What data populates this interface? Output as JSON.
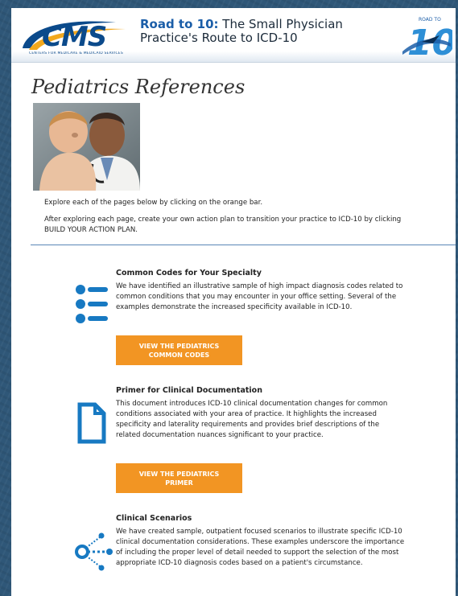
{
  "header": {
    "logo_text": "CMS",
    "logo_subtitle": "CENTERS FOR MEDICARE & MEDICAID SERVICES",
    "title_bold": "Road to 10:",
    "title_rest": " The Small Physician Practice's Route to ICD-10",
    "badge_top": "ROAD TO",
    "badge_number": "10"
  },
  "page": {
    "title": "Pediatrics References",
    "intro_1": "Explore each of the pages below by clicking on the orange bar.",
    "intro_2": "After exploring each page, create your own action plan to transition your practice to ICD-10 by clicking BUILD YOUR ACTION PLAN."
  },
  "sections": [
    {
      "title": "Common Codes for Your Specialty",
      "body": "We have identified an illustrative sample of high impact diagnosis codes related to common conditions that you may encounter in your office setting. Several of the examples demonstrate the increased specificity available in ICD-10.",
      "button_line1": "VIEW THE PEDIATRICS",
      "button_line2": "COMMON CODES",
      "icon": "list-icon"
    },
    {
      "title": "Primer for Clinical Documentation",
      "body": "This document introduces ICD-10 clinical documentation changes for common conditions associated with your area of practice. It highlights the increased specificity and laterality requirements and provides brief descriptions of the related documentation nuances significant to your practice.",
      "button_line1": "VIEW THE PEDIATRICS",
      "button_line2": "PRIMER",
      "icon": "document-icon"
    },
    {
      "title": "Clinical Scenarios",
      "body": "We have created sample, outpatient focused scenarios to illustrate specific ICD-10 clinical documentation considerations. These examples underscore the importance of including the proper level of detail needed to support the selection of the most appropriate ICD-10 diagnosis codes based on a patient's circumstance.",
      "icon": "network-icon"
    }
  ],
  "colors": {
    "accent_orange": "#f29523",
    "icon_blue": "#1779c2",
    "brand_blue": "#0b4a8b",
    "divider_blue": "#5a86b6"
  }
}
